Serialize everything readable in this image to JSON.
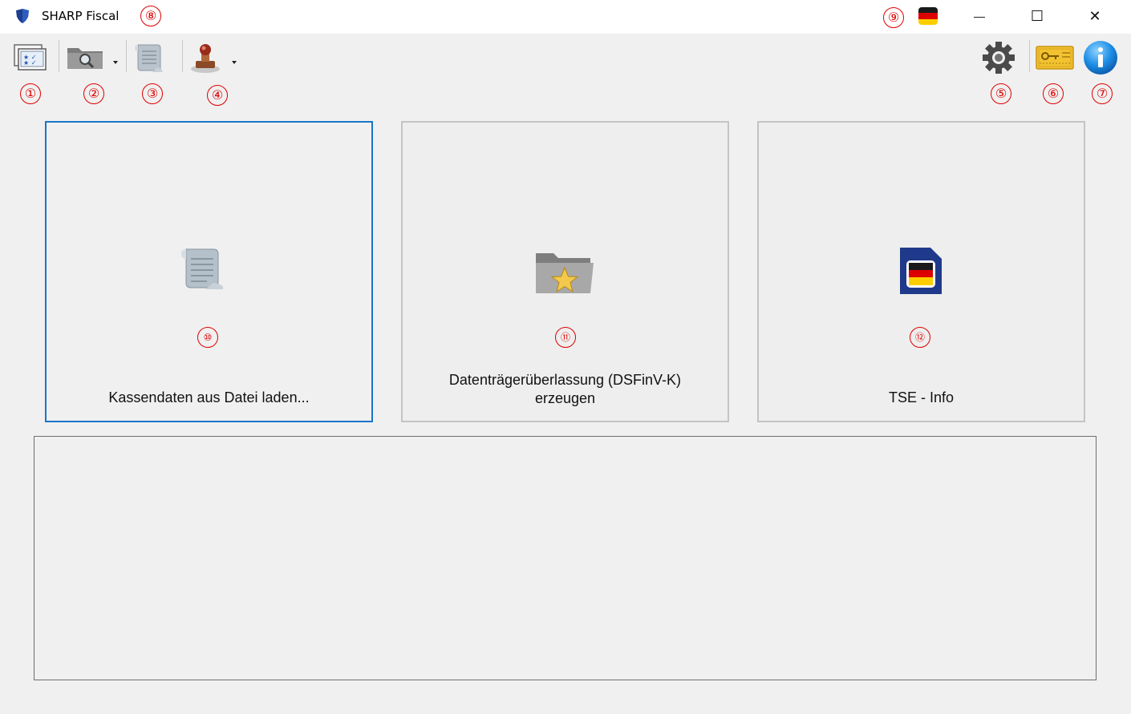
{
  "window": {
    "title": "SHARP Fiscal",
    "minimize_glyph": "—",
    "maximize_glyph": "☐",
    "close_glyph": "✕"
  },
  "language_flag": {
    "colors": [
      "#1a1a1a",
      "#dd0000",
      "#ffce00"
    ]
  },
  "badges": {
    "b1": "①",
    "b2": "②",
    "b3": "③",
    "b4": "④",
    "b5": "⑤",
    "b6": "⑥",
    "b7": "⑦",
    "b8": "⑧",
    "b9": "⑨",
    "b10": "⑩",
    "b11": "⑪",
    "b12": "⑫"
  },
  "toolbar": {
    "left": [
      {
        "icon": "register-layout-icon"
      },
      {
        "icon": "folder-search-icon",
        "dropdown": true
      },
      {
        "icon": "document-scroll-icon"
      },
      {
        "icon": "stamp-icon",
        "dropdown": true
      }
    ],
    "right": [
      {
        "icon": "gear-icon"
      },
      {
        "icon": "license-key-icon"
      },
      {
        "icon": "info-icon",
        "glyph": "i"
      }
    ]
  },
  "tiles": [
    {
      "label": "Kassendaten aus Datei laden...",
      "icon": "document-scroll-icon"
    },
    {
      "label_line1": "Datenträgerüberlassung (DSFinV-K)",
      "label_line2": "erzeugen",
      "icon": "star-folder-icon"
    },
    {
      "label": "TSE - Info",
      "icon": "sd-card-flag-icon"
    }
  ],
  "colors": {
    "badge": "#e00000",
    "selection": "#1a75c7",
    "titlebar": "#ffffff",
    "background": "#f0f0f0"
  }
}
